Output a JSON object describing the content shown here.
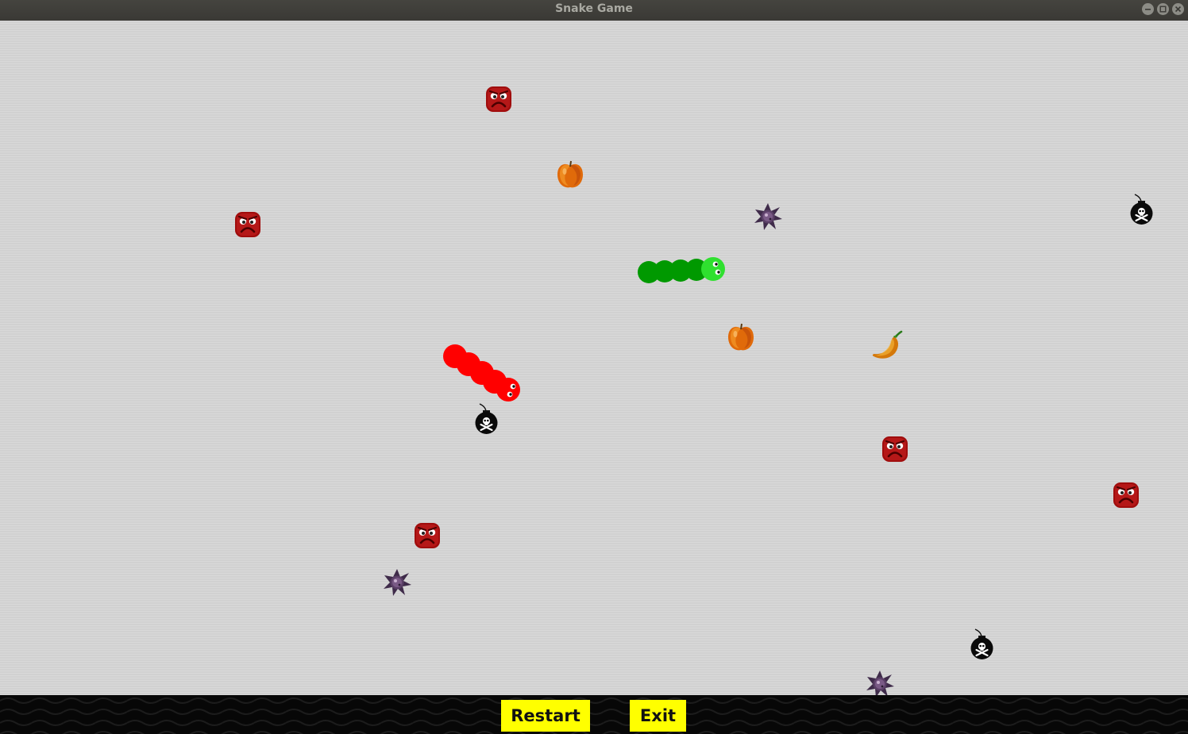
{
  "window": {
    "title": "Snake Game"
  },
  "controls": {
    "restart_label": "Restart",
    "exit_label": "Exit"
  },
  "colors": {
    "board": "#d5d5d5",
    "bottom_bar": "#070707",
    "button": "#ffff00",
    "player_snake": "#ff0000",
    "enemy_snake": "#009900",
    "enemy_snake_head": "#33dd33"
  },
  "snakes": [
    {
      "name": "red-snake",
      "segments": 5,
      "color": "#ff0000"
    },
    {
      "name": "green-snake",
      "segments": 5,
      "color": "#009900"
    }
  ],
  "items": {
    "apples": 2,
    "chili": 1,
    "bombs": 3,
    "angry_blocks": 5,
    "spiky_mines": 3
  }
}
